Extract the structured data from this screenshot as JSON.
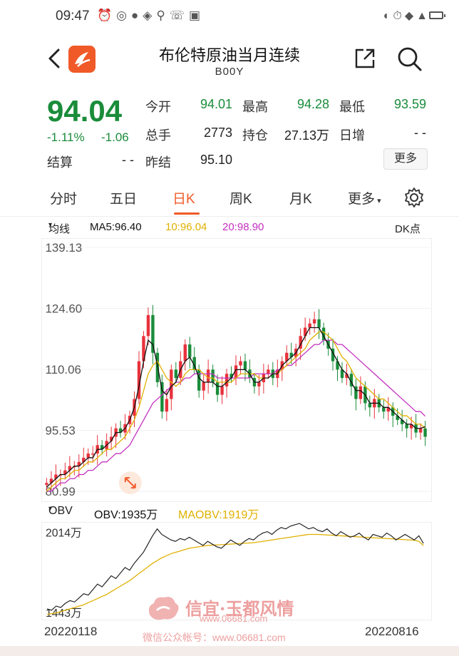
{
  "status": {
    "time": "09:47"
  },
  "header": {
    "title": "布伦特原油当月连续",
    "code": "B00Y"
  },
  "quote": {
    "price": "94.04",
    "change_pct": "-1.11%",
    "change_abs": "-1.06",
    "open_label": "今开",
    "open": "94.01",
    "high_label": "最高",
    "high": "94.28",
    "low_label": "最低",
    "low": "93.59",
    "volume_label": "总手",
    "volume": "2773",
    "oi_label": "持仓",
    "oi": "27.13万",
    "daily_inc_label": "日增",
    "daily_inc": "- -",
    "settle_label": "结算",
    "settle": "- -",
    "prev_settle_label": "昨结",
    "prev_settle": "95.10",
    "more_label": "更多"
  },
  "tabs": [
    {
      "label": "分时"
    },
    {
      "label": "五日"
    },
    {
      "label": "日K"
    },
    {
      "label": "周K"
    },
    {
      "label": "月K"
    },
    {
      "label": "更多"
    }
  ],
  "colors": {
    "up": "#e8323c",
    "down": "#1a8c3a",
    "accent": "#f05a28",
    "ma5": "#111111",
    "ma10": "#e0b000",
    "ma20": "#c430c0",
    "maobv": "#e0b000"
  },
  "ma_bar": {
    "selector": "均线",
    "ma5": "MA5:96.40",
    "ma10": "10:96.04",
    "ma20": "20:98.90",
    "dk": "DK点"
  },
  "obv_bar": {
    "selector": "OBV",
    "obv": "OBV:1935万",
    "maobv": "MAOBV:1919万"
  },
  "chart_data": [
    {
      "type": "candlestick",
      "y_ticks": [
        "139.13",
        "124.60",
        "110.06",
        "95.53",
        "80.99"
      ],
      "ylim": [
        80.99,
        139.13
      ],
      "x_start": "20220118",
      "x_end": "20220816",
      "closes": [
        83,
        84,
        85,
        85,
        86,
        87,
        87,
        88,
        89,
        90,
        90,
        92,
        91,
        93,
        94,
        96,
        95,
        97,
        99,
        103,
        112,
        118,
        123,
        114,
        107,
        100,
        103,
        110,
        108,
        112,
        116,
        113,
        110,
        105,
        107,
        110,
        107,
        104,
        106,
        109,
        108,
        111,
        112,
        110,
        108,
        106,
        107,
        109,
        110,
        108,
        110,
        112,
        114,
        113,
        115,
        118,
        120,
        121,
        122,
        120,
        117,
        115,
        112,
        110,
        108,
        109,
        106,
        103,
        106,
        102,
        101,
        103,
        101,
        100,
        101,
        99,
        98,
        97,
        96,
        97,
        95,
        96,
        94
      ],
      "ma5": [
        82,
        83,
        84,
        85,
        85,
        86,
        87,
        87,
        88,
        89,
        89,
        91,
        91,
        92,
        93,
        95,
        95,
        96,
        98,
        101,
        106,
        112,
        117,
        116,
        111,
        105,
        104,
        106,
        107,
        110,
        112,
        113,
        111,
        108,
        107,
        107,
        107,
        106,
        106,
        107,
        108,
        110,
        110,
        110,
        109,
        107,
        107,
        108,
        108,
        109,
        109,
        111,
        112,
        113,
        114,
        116,
        118,
        120,
        120,
        120,
        118,
        116,
        114,
        112,
        110,
        109,
        107,
        105,
        105,
        104,
        102,
        102,
        102,
        101,
        101,
        100,
        99,
        98,
        97,
        97,
        96,
        96,
        96.4
      ],
      "ma10": [
        81,
        82,
        83,
        84,
        84,
        85,
        86,
        86,
        87,
        88,
        88,
        89,
        90,
        91,
        91,
        92,
        93,
        94,
        96,
        98,
        101,
        105,
        109,
        111,
        112,
        110,
        108,
        107,
        106,
        107,
        109,
        110,
        110,
        110,
        109,
        108,
        108,
        107,
        107,
        107,
        107,
        108,
        109,
        109,
        109,
        109,
        108,
        108,
        108,
        109,
        109,
        110,
        111,
        112,
        113,
        114,
        115,
        117,
        118,
        119,
        119,
        118,
        117,
        115,
        113,
        112,
        110,
        108,
        107,
        106,
        105,
        104,
        103,
        103,
        102,
        101,
        100,
        99,
        99,
        98,
        97,
        97,
        96.04
      ],
      "ma20": [
        81,
        81,
        82,
        83,
        83,
        84,
        84,
        85,
        85,
        86,
        86,
        87,
        88,
        88,
        89,
        90,
        90,
        91,
        92,
        94,
        96,
        98,
        100,
        102,
        103,
        104,
        105,
        106,
        107,
        107,
        108,
        108,
        109,
        109,
        109,
        109,
        109,
        108,
        108,
        108,
        108,
        108,
        108,
        108,
        108,
        109,
        109,
        109,
        109,
        109,
        110,
        110,
        111,
        111,
        112,
        113,
        114,
        115,
        116,
        116,
        117,
        117,
        117,
        116,
        116,
        115,
        114,
        113,
        112,
        111,
        110,
        109,
        108,
        107,
        106,
        105,
        104,
        103,
        102,
        101,
        100,
        100,
        98.9
      ]
    },
    {
      "type": "line",
      "series_name": "OBV",
      "y_ticks": [
        "2014万",
        "1443万"
      ],
      "ylim": [
        1443,
        2014
      ],
      "obv": [
        1460,
        1450,
        1480,
        1470,
        1500,
        1520,
        1510,
        1540,
        1570,
        1560,
        1600,
        1640,
        1620,
        1660,
        1700,
        1680,
        1720,
        1760,
        1740,
        1790,
        1830,
        1870,
        1930,
        1990,
        2040,
        2000,
        1980,
        1960,
        1950,
        1970,
        1960,
        1980,
        1960,
        1940,
        1920,
        1950,
        1930,
        1910,
        1900,
        1930,
        1960,
        1940,
        1920,
        1950,
        1970,
        1960,
        1990,
        2010,
        2020,
        2000,
        2030,
        2050,
        2040,
        2060,
        2070,
        2080,
        2060,
        2040,
        2050,
        2030,
        2020,
        2040,
        2010,
        1990,
        2020,
        2000,
        1980,
        1990,
        2010,
        1980,
        1960,
        2000,
        1990,
        1980,
        2010,
        1990,
        1960,
        1980,
        2000,
        1980,
        1960,
        1990,
        1935
      ],
      "maobv": [
        1420,
        1425,
        1430,
        1440,
        1450,
        1460,
        1470,
        1480,
        1490,
        1505,
        1520,
        1535,
        1550,
        1565,
        1585,
        1605,
        1625,
        1645,
        1665,
        1690,
        1715,
        1740,
        1765,
        1790,
        1810,
        1830,
        1845,
        1860,
        1870,
        1880,
        1890,
        1900,
        1905,
        1910,
        1915,
        1920,
        1922,
        1924,
        1926,
        1928,
        1930,
        1932,
        1934,
        1936,
        1938,
        1940,
        1945,
        1950,
        1955,
        1960,
        1965,
        1970,
        1975,
        1980,
        1985,
        1990,
        1995,
        2000,
        2000,
        2000,
        1998,
        1996,
        1994,
        1992,
        1990,
        1988,
        1986,
        1984,
        1982,
        1980,
        1978,
        1976,
        1974,
        1972,
        1970,
        1968,
        1966,
        1964,
        1962,
        1960,
        1958,
        1950,
        1919
      ]
    }
  ],
  "watermark": {
    "title": "信宜·玉都风情",
    "url": "www.06681.com",
    "sub": "微信公众帐号：www.06681.com"
  }
}
